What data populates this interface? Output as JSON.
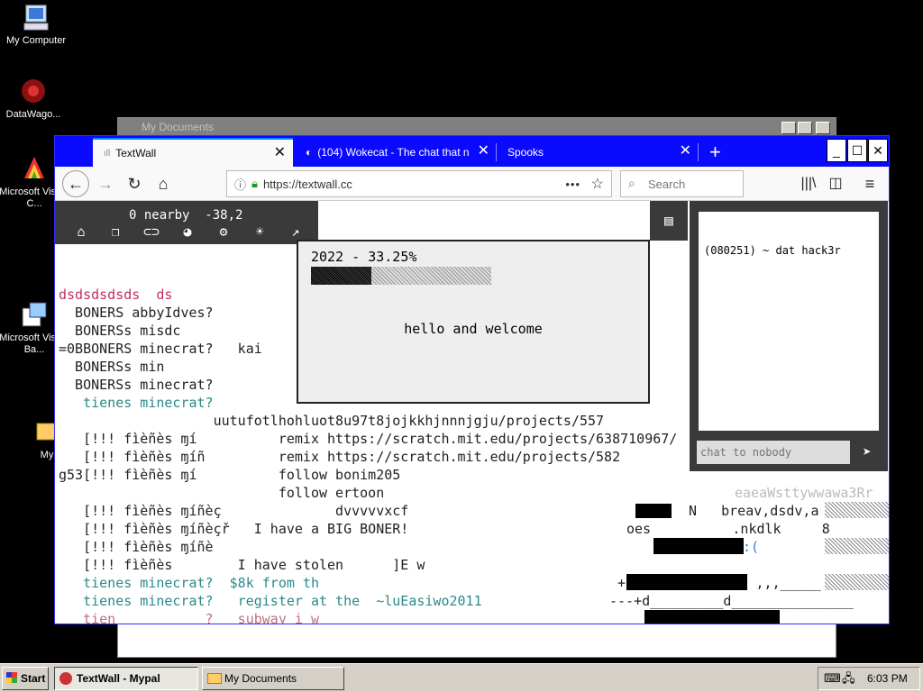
{
  "desktop": {
    "icons": [
      {
        "label": "My Computer"
      },
      {
        "label": "DataWago..."
      },
      {
        "label": "Microsoft Visual C..."
      },
      {
        "label": "Microsoft Visual Ba..."
      },
      {
        "label": "My"
      }
    ]
  },
  "bg_window": {
    "title": "My Documents"
  },
  "browser": {
    "tabs": [
      {
        "label": "TextWall",
        "active": true
      },
      {
        "label": "(104) Wokecat - The chat that ne",
        "active": false
      },
      {
        "label": "Spooks",
        "active": false
      }
    ],
    "url": "https://textwall.cc",
    "search_placeholder": "Search"
  },
  "textwall": {
    "coords_text": "0 nearby  -38,2",
    "announcement": {
      "progress_label": "2022 - 33.25%",
      "progress": 0.3325,
      "message": "hello and welcome"
    },
    "chat": {
      "messages": [
        "(080251) ~ dat hack3r"
      ],
      "input_placeholder": "chat to nobody"
    },
    "lines": [
      "dsdsdsdsds  ds",
      "  BONERS abbyIdves?",
      "  BONERSs misdc",
      "=0BBONERS minecrat?   kai",
      "  BONERSs min",
      "  BONERSs minecrat?",
      "   tienes minecrat?",
      "                   uutufotlhohluot8u97t8jojkkhjnnnjgju/projects/557",
      "   [!!! fìèñès ɱí          remix https://scratch.mit.edu/projects/638710967/",
      "   [!!! fìèñès ɱíñ         remix https://scratch.mit.edu/projects/582",
      "g53[!!! fìèñès ɱí          follow bonim205",
      "                           follow ertoon",
      "   [!!! fìèñès ɱíñèç              dvvvvvxcf",
      "   [!!! fìèñès ɱíñèçř   I have a BIG BONER!",
      "   [!!! fìèñès ɱíñè",
      "   [!!! fìèñès        I have stolen      ]E w",
      "   tienes minecrat?  $8k from th",
      "   tienes minecrat?   register at the  ~luEasiwo2011",
      "   tien           ?   subway i w"
    ],
    "right_lines": [
      "eaeaWsttywwawa3Rr",
      "N   breav,dsdv,a",
      "oes          .nkdlk     8",
      ":(",
      "+                ,,,_____",
      "---+d_________d_______________"
    ]
  },
  "taskbar": {
    "start_label": "Start",
    "tasks": [
      {
        "label": "TextWall - Mypal",
        "active": true
      },
      {
        "label": "My Documents",
        "active": false
      }
    ],
    "clock": "6:03 PM"
  }
}
